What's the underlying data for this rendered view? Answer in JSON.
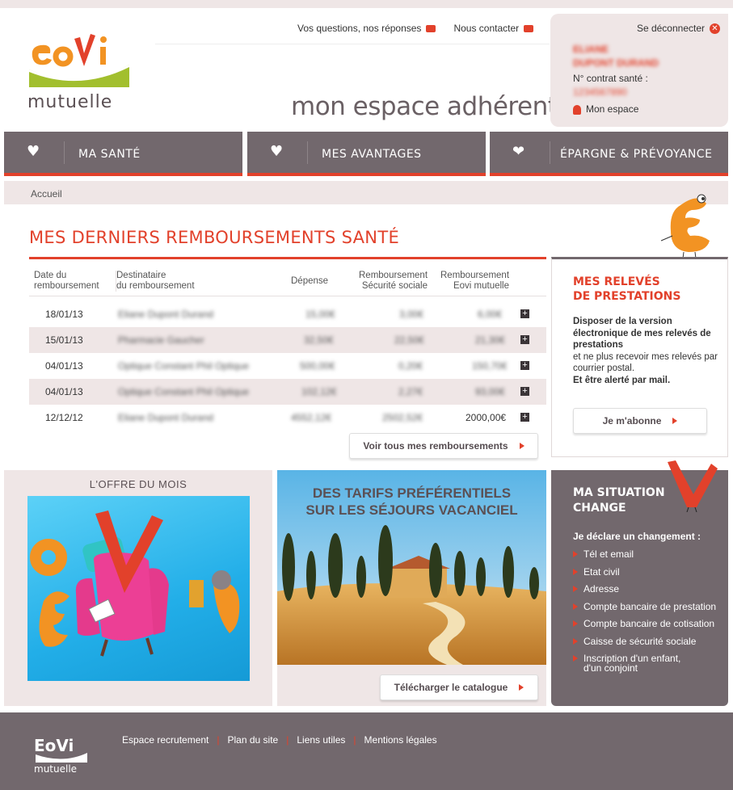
{
  "brand": {
    "logo_text": "mutuelle",
    "logo_letters": "EoVi"
  },
  "header": {
    "faq_link": "Vos questions, nos réponses",
    "contact_link": "Nous contacter",
    "title": "mon espace adhérent"
  },
  "user": {
    "logout": "Se déconnecter",
    "first_name": "ELIANE",
    "last_name": "DUPONT DURAND",
    "contract_label": "N° contrat santé :",
    "contract_number": "1234567890",
    "my_space": "Mon espace"
  },
  "nav": [
    {
      "label": "MA SANTÉ",
      "icon": "heart-pulse-icon"
    },
    {
      "label": "MES AVANTAGES",
      "icon": "heart-plus-icon"
    },
    {
      "label": "ÉPARGNE & PRÉVOYANCE",
      "icon": "hands-heart-icon"
    }
  ],
  "breadcrumb": "Accueil",
  "reimb": {
    "title": "MES DERNIERS REMBOURSEMENTS SANTÉ",
    "headers": {
      "date_1": "Date du",
      "date_2": "remboursement",
      "dest_1": "Destinataire",
      "dest_2": "du remboursement",
      "depense": "Dépense",
      "secu_1": "Remboursement",
      "secu_2": "Sécurité sociale",
      "eovi_1": "Remboursement",
      "eovi_2": "Eovi mutuelle"
    },
    "rows": [
      {
        "date": "18/01/13",
        "dest": "Eliane Dupont Durand",
        "depense": "15,00€",
        "secu": "3,00€",
        "eovi": "6,00€"
      },
      {
        "date": "15/01/13",
        "dest": "Pharmacie Gaucher",
        "depense": "32,50€",
        "secu": "22,50€",
        "eovi": "21,30€"
      },
      {
        "date": "04/01/13",
        "dest": "Optique Constant Phil Optique",
        "depense": "500,00€",
        "secu": "0,20€",
        "eovi": "150,70€"
      },
      {
        "date": "04/01/13",
        "dest": "Optique Constant Phil Optique",
        "depense": "102,12€",
        "secu": "2,27€",
        "eovi": "93,00€"
      },
      {
        "date": "12/12/12",
        "dest": "Eliane Dupont Durand",
        "depense": "4552,12€",
        "secu": "2502,52€",
        "eovi": "2000,00€"
      }
    ],
    "see_all": "Voir tous mes remboursements"
  },
  "releves": {
    "title_1": "MES RELEVÉS",
    "title_2": "DE PRESTATIONS",
    "text_bold": "Disposer de la version électronique de mes relevés de prestations",
    "text_normal": "et ne plus recevoir mes relevés par courrier postal.",
    "text_bold_2": "Et être alerté par mail.",
    "button": "Je m'abonne"
  },
  "offre": {
    "title": "L'OFFRE DU MOIS"
  },
  "tarifs": {
    "title_1": "DES TARIFS PRÉFÉRENTIELS",
    "title_2": "SUR LES SÉJOURS VACANCIEL",
    "button": "Télécharger le catalogue"
  },
  "situation": {
    "title_1": "MA SITUATION",
    "title_2": "CHANGE",
    "subtitle": "Je déclare un changement :",
    "items": [
      "Tél et email",
      "Etat civil",
      "Adresse",
      "Compte bancaire de prestation",
      "Compte bancaire de cotisation",
      "Caisse de sécurité sociale",
      "Inscription d'un enfant,",
      "d'un conjoint"
    ]
  },
  "footer": {
    "links": [
      "Espace recrutement",
      "Plan du site",
      "Liens utiles",
      "Mentions légales"
    ]
  },
  "colors": {
    "accent": "#e2412b",
    "nav_bg": "#72686d",
    "panel_bg": "#efe6e6",
    "logo_orange": "#f29323",
    "logo_green": "#a2bf2e"
  }
}
